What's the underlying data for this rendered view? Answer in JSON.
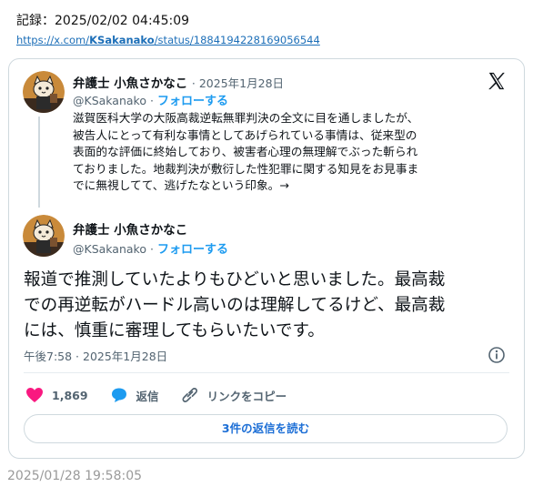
{
  "record": {
    "label": "記録：2025/02/02 04:45:09",
    "url_prefix": "https://x.com/",
    "url_handle": "KSakanako",
    "url_suffix": "/status/1884194228169056544"
  },
  "quoted_tweet": {
    "author_name": "弁護士 小魚さかなこ",
    "date": "· 2025年1月28日",
    "handle": "@KSakanako ·",
    "follow_label": "フォローする",
    "text_lines": [
      "滋賀医科大学の大阪高裁逆転無罪判決の全文に目を通しましたが、",
      "被告人にとって有利な事情としてあげられている事情は、従来型の",
      "表面的な評価に終始しており、被害者心理の無理解でぶった斬られ",
      "ておりました。地裁判決が敷衍した性犯罪に関する知見をお見事ま",
      "でに無視してて、逃げたなという印象。→"
    ]
  },
  "main_tweet": {
    "author_name": "弁護士 小魚さかなこ",
    "handle": "@KSakanako ·",
    "follow_label": "フォローする",
    "text_lines": [
      "報道で推測していたよりもひどいと思いました。最高裁",
      "での再逆転がハードル高いのは理解してるけど、最高裁",
      "には、慎重に審理してもらいたいです。"
    ],
    "timestamp": "午後7:58 · 2025年1月28日"
  },
  "actions": {
    "likes": "1,869",
    "reply_label": "返信",
    "copy_link_label": "リンクをコピー"
  },
  "replies_button": "3件の返信を読む",
  "bottom_timestamp": "2025/01/28 19:58:05",
  "colors": {
    "accent": "#1d9bf0",
    "like": "#f91880",
    "text": "#0f1419",
    "muted": "#536471",
    "border": "#cfd9de"
  },
  "icons": [
    "x-logo-icon",
    "info-icon",
    "heart-icon",
    "reply-bubble-icon",
    "link-icon",
    "avatar-cat-icon"
  ]
}
